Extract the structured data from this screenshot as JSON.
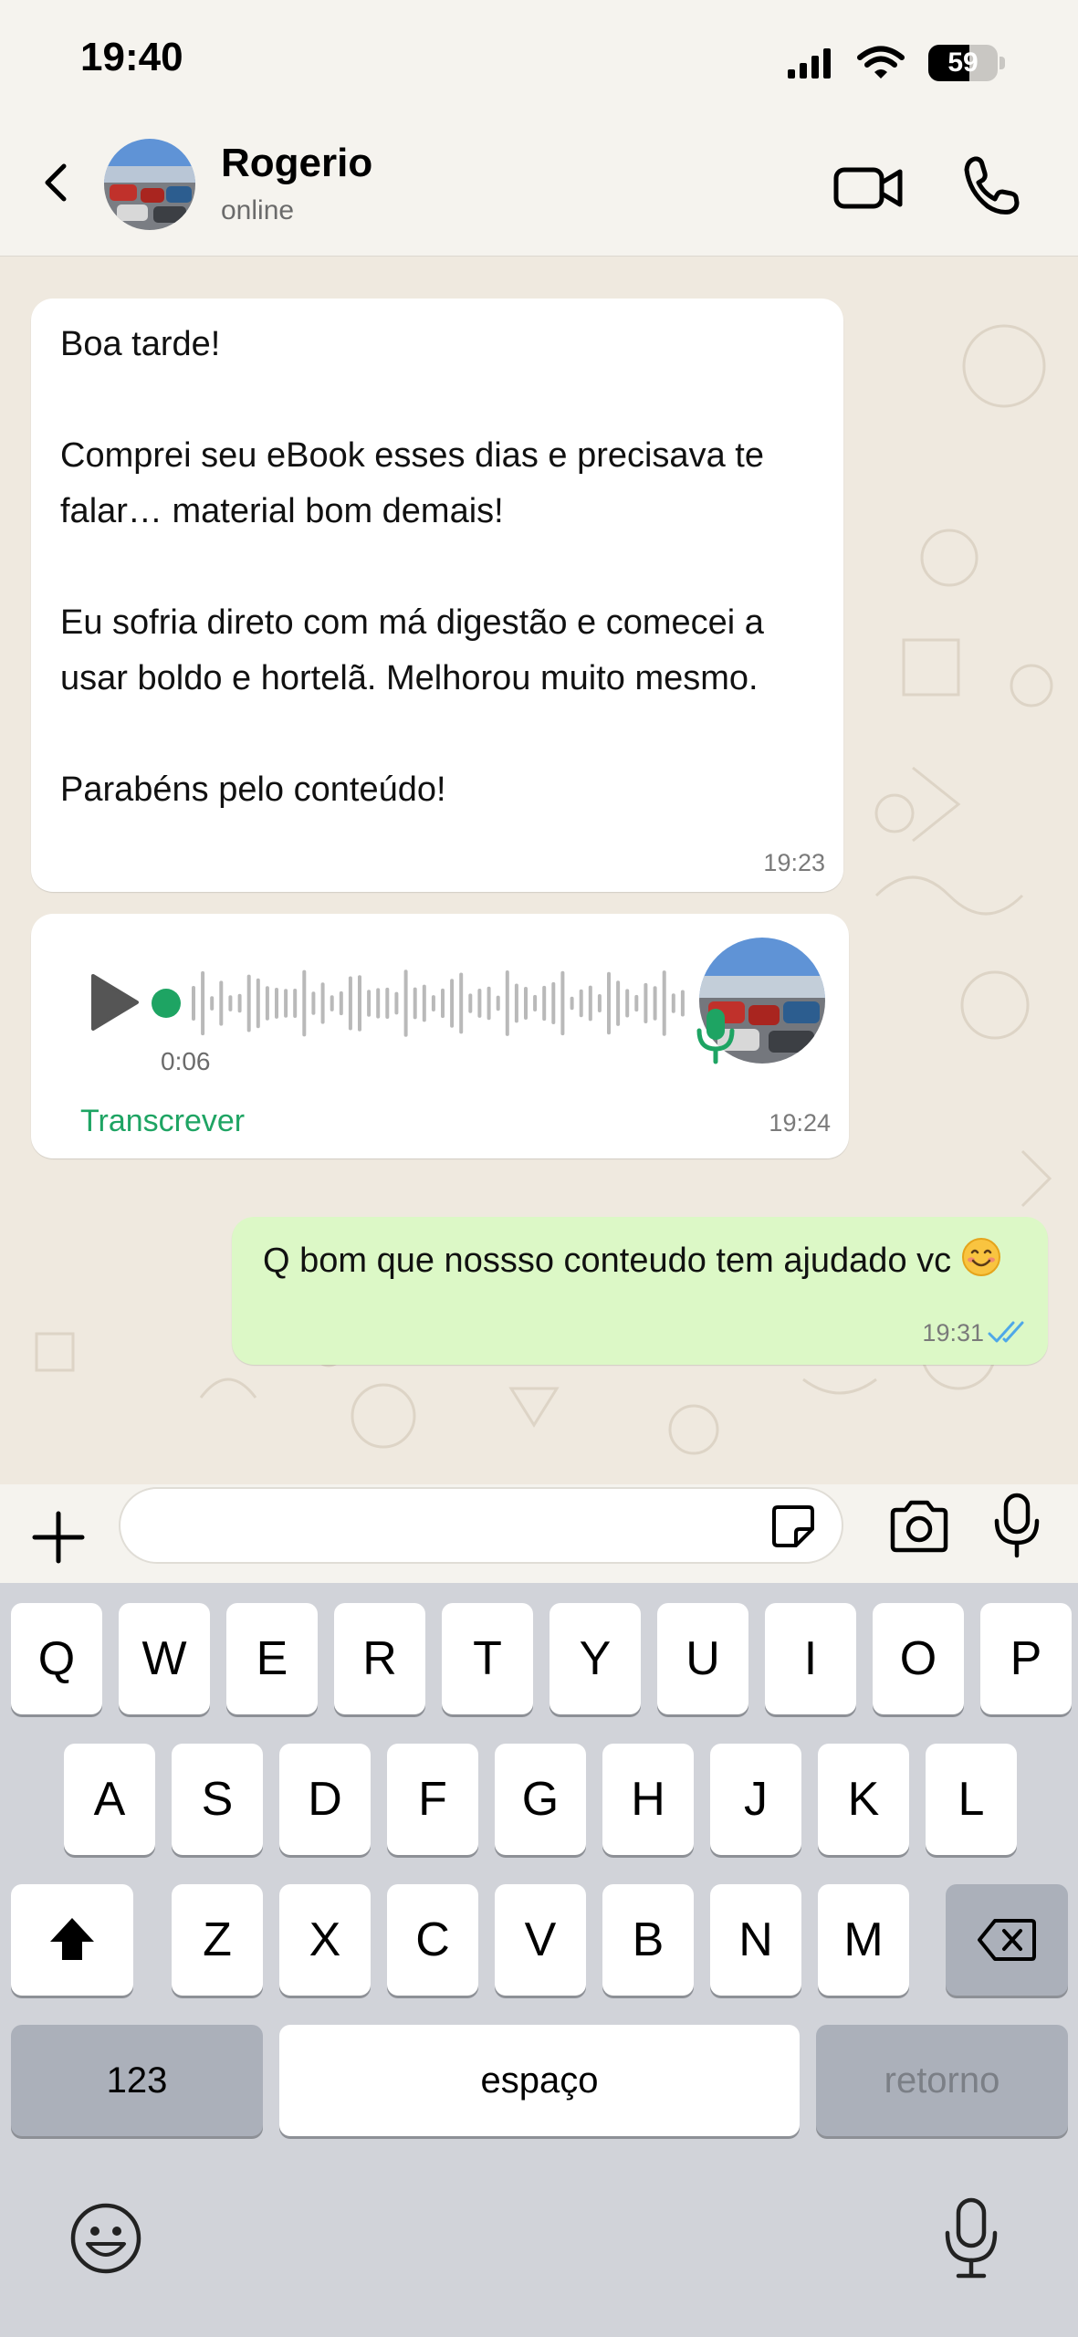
{
  "status_bar": {
    "time": "19:40",
    "battery": "59",
    "battery_level": 0.59
  },
  "header": {
    "contact_name": "Rogerio",
    "contact_status": "online"
  },
  "messages": [
    {
      "type": "text",
      "direction": "incoming",
      "paragraphs": [
        "Boa tarde!",
        "Comprei seu eBook esses dias e precisava te falar… material bom demais!",
        "Eu sofria direto com má digestão e comecei a usar boldo e hortelã. Melhorou muito mesmo.",
        "Parabéns pelo conteúdo!"
      ],
      "time": "19:23"
    },
    {
      "type": "voice",
      "direction": "incoming",
      "duration": "0:06",
      "progress": 0,
      "action_label": "Transcrever",
      "time": "19:24"
    },
    {
      "type": "text",
      "direction": "outgoing",
      "text": "Q bom que nossso conteudo tem ajudado vc",
      "emoji": "smiling-face-emoji",
      "time": "19:31",
      "status": "read"
    }
  ],
  "keyboard": {
    "row1": [
      "Q",
      "W",
      "E",
      "R",
      "T",
      "Y",
      "U",
      "I",
      "O",
      "P"
    ],
    "row2": [
      "A",
      "S",
      "D",
      "F",
      "G",
      "H",
      "J",
      "K",
      "L"
    ],
    "row3": [
      "Z",
      "X",
      "C",
      "V",
      "B",
      "N",
      "M"
    ],
    "numbers_label": "123",
    "space_label": "espaço",
    "return_label": "retorno"
  },
  "icons": [
    "back-icon",
    "video-call-icon",
    "phone-icon",
    "play-icon",
    "mic-icon",
    "plus-icon",
    "sticker-icon",
    "camera-icon",
    "shift-icon",
    "backspace-icon",
    "emoji-icon",
    "dictation-icon"
  ],
  "colors": {
    "accent": "#1ea463",
    "outgoing_bubble": "#dcf8c6",
    "read_ticks": "#4fa8e8",
    "chat_background": "#efe9df"
  }
}
